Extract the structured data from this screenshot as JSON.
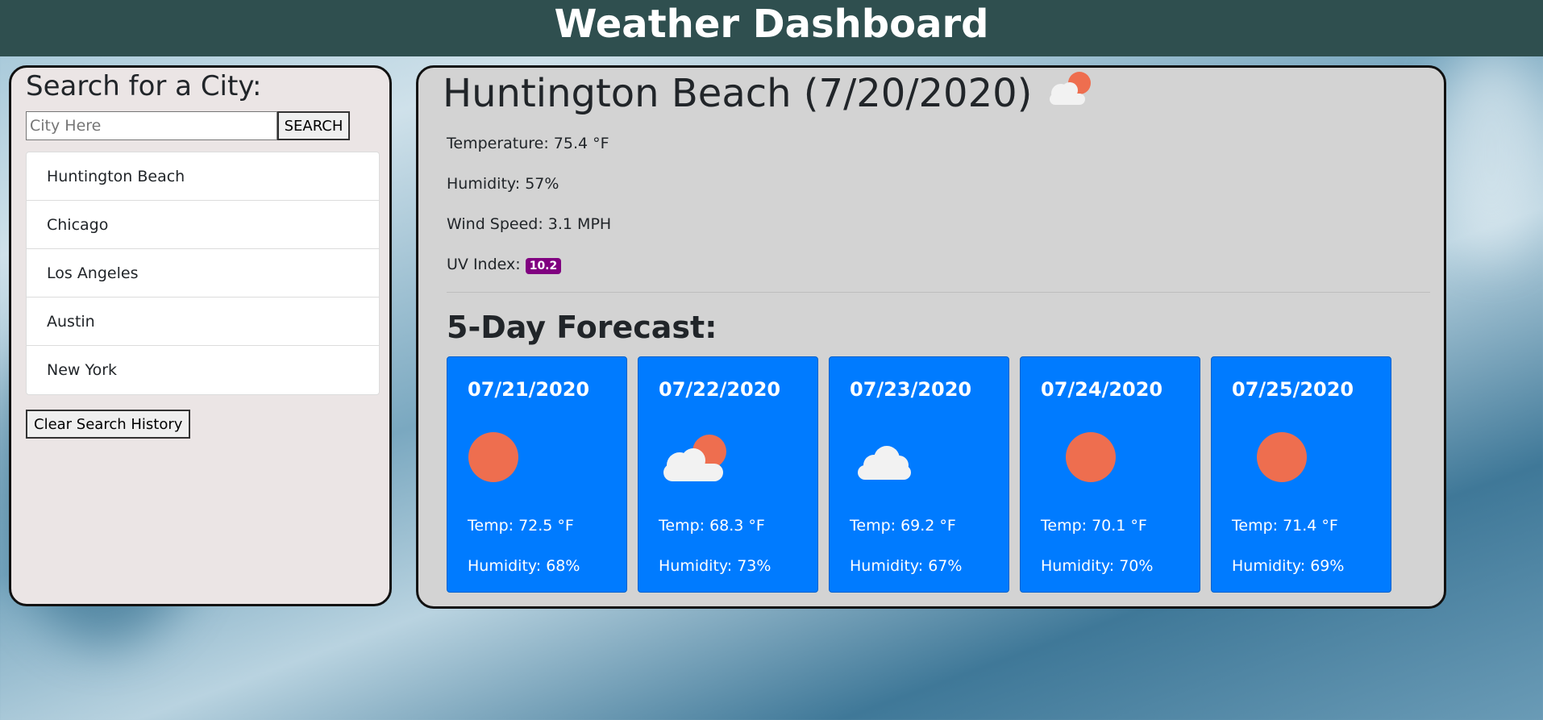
{
  "header": {
    "title": "Weather Dashboard"
  },
  "sidebar": {
    "heading": "Search for a City:",
    "search_placeholder": "City Here",
    "search_button": "SEARCH",
    "history": [
      "Huntington Beach",
      "Chicago",
      "Los Angeles",
      "Austin",
      "New York"
    ],
    "clear_button": "Clear Search History"
  },
  "current": {
    "title": "Huntington Beach (7/20/2020)",
    "icon": "partly-cloudy-icon",
    "temperature": "Temperature: 75.4 °F",
    "humidity": "Humidity: 57%",
    "wind": "Wind Speed: 3.1 MPH",
    "uv_label": "UV Index:",
    "uv_value": "10.2",
    "uv_color": "#800080"
  },
  "forecast": {
    "title": "5-Day Forecast:",
    "days": [
      {
        "date": "07/21/2020",
        "icon": "sun-icon",
        "temp": "Temp: 72.5 °F",
        "humidity": "Humidity: 68%"
      },
      {
        "date": "07/22/2020",
        "icon": "partly-cloudy-icon",
        "temp": "Temp: 68.3 °F",
        "humidity": "Humidity: 73%"
      },
      {
        "date": "07/23/2020",
        "icon": "cloud-icon",
        "temp": "Temp: 69.2 °F",
        "humidity": "Humidity: 67%"
      },
      {
        "date": "07/24/2020",
        "icon": "sun-icon",
        "temp": "Temp: 70.1 °F",
        "humidity": "Humidity: 70%"
      },
      {
        "date": "07/25/2020",
        "icon": "sun-icon",
        "temp": "Temp: 71.4 °F",
        "humidity": "Humidity: 69%"
      }
    ]
  },
  "colors": {
    "header": "#2f4f4f",
    "card": "#007bff",
    "sun": "#ee6e4f"
  }
}
